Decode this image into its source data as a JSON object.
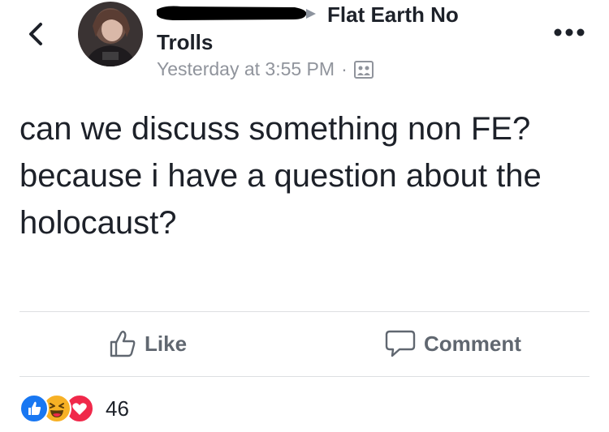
{
  "header": {
    "back_icon": "chevron-left-icon",
    "author_name": "",
    "arrow_icon": "triangle-right-icon",
    "group_name_line1": "Flat Earth No",
    "group_name_line2": "Trolls",
    "timestamp": "Yesterday at 3:55 PM",
    "separator": "·",
    "audience_icon": "group-icon",
    "more_icon": "more-icon"
  },
  "post": {
    "paragraphs": [
      "can we discuss something non FE?",
      "because i have a question about the holocaust?"
    ]
  },
  "actions": {
    "like_label": "Like",
    "comment_label": "Comment"
  },
  "reactions": {
    "types": [
      "like",
      "haha",
      "love"
    ],
    "count": "46",
    "colors": {
      "like": "#1877f2",
      "haha": "#f7b125",
      "love": "#f0284a"
    }
  }
}
